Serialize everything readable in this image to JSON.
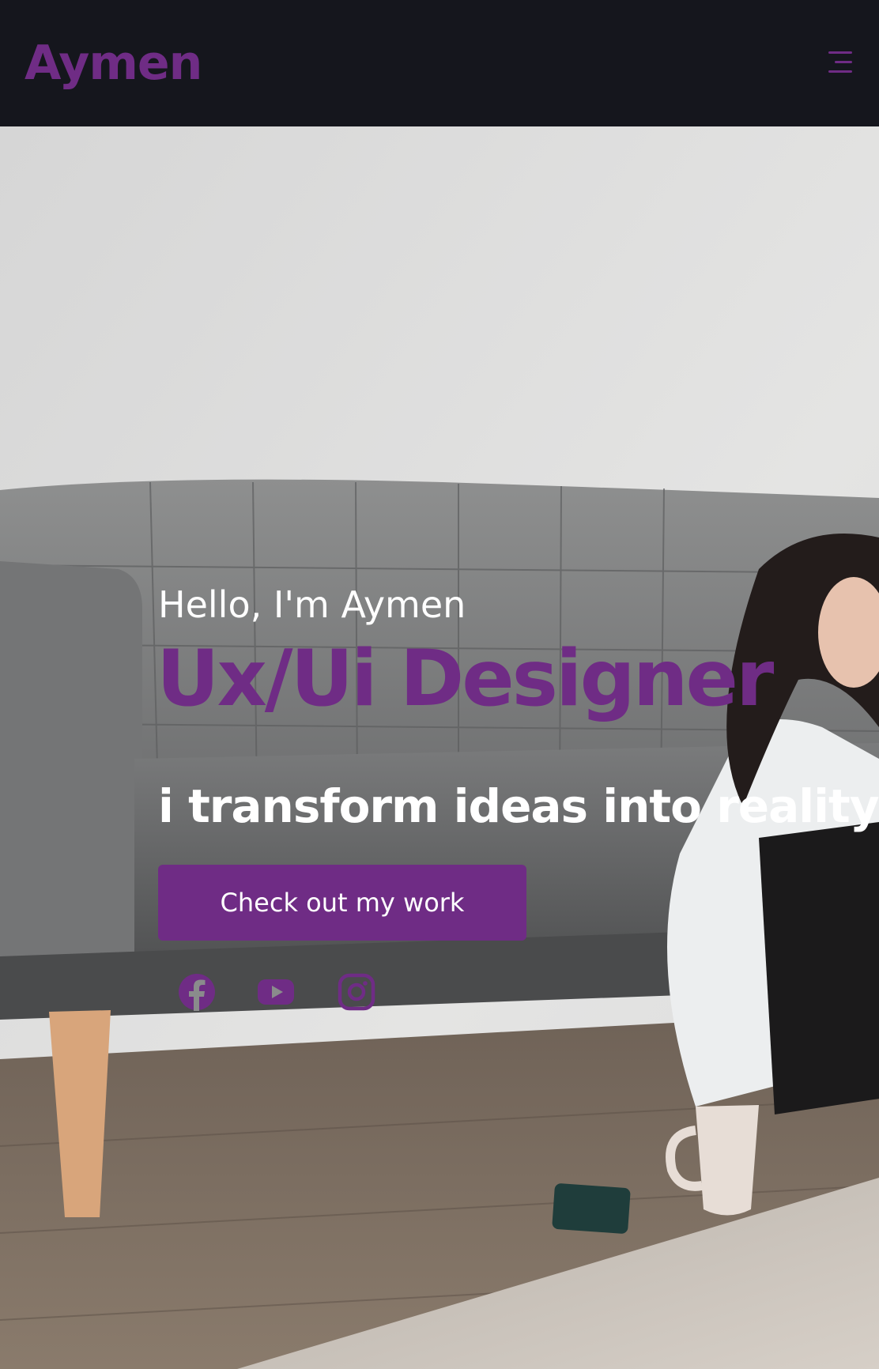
{
  "header": {
    "logo": "Aymen",
    "menu_icon": "hamburger-menu-icon"
  },
  "hero": {
    "greeting": "Hello, I'm Aymen",
    "role": "Ux/Ui Designer",
    "tagline": "i transform ideas into reality",
    "cta_label": "Check out my work",
    "background": "woman-with-laptop-beside-grey-sofa-photo",
    "socials": [
      {
        "icon": "facebook-icon"
      },
      {
        "icon": "youtube-icon"
      },
      {
        "icon": "instagram-icon"
      }
    ]
  },
  "colors": {
    "accent": "#6f2c85",
    "header_bg": "#15161d",
    "text_light": "#ffffff"
  }
}
